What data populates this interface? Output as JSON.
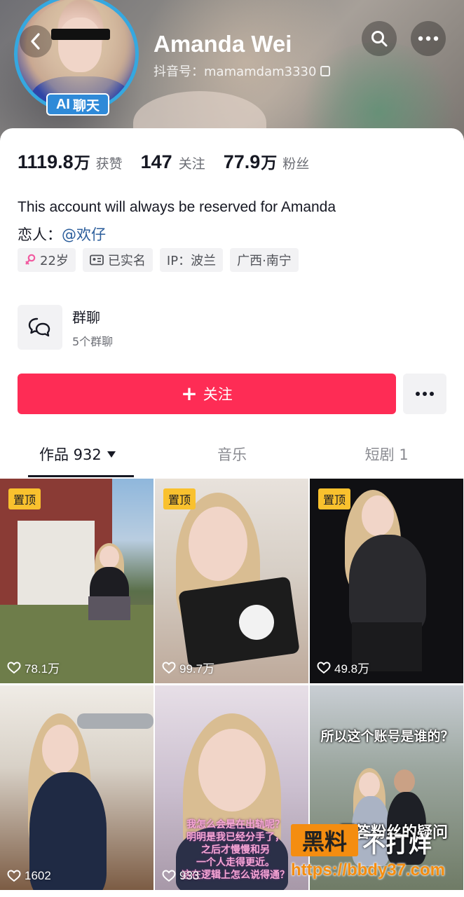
{
  "profile": {
    "name": "Amanda Wei",
    "douyin_id": "抖音号：mamamdam3330",
    "ai_badge_prefix": "AI",
    "ai_badge_label": "聊天"
  },
  "stats": [
    {
      "num": "1119.8",
      "unit": "万",
      "label": "获赞"
    },
    {
      "num": "147",
      "unit": "",
      "label": "关注"
    },
    {
      "num": "77.9",
      "unit": "万",
      "label": "粉丝"
    }
  ],
  "bio": "This account will always be reserved for Amanda",
  "lover": {
    "label": "恋人：",
    "mention": "@欢仔"
  },
  "tags": [
    {
      "icon": "female-icon",
      "text": "22岁"
    },
    {
      "icon": "id-card-icon",
      "text": "已实名"
    },
    {
      "icon": "",
      "text": "IP：波兰"
    },
    {
      "icon": "",
      "text": "广西·南宁"
    }
  ],
  "group_chat": {
    "title": "群聊",
    "subtitle": "5个群聊"
  },
  "follow_button": {
    "label": "关注"
  },
  "tabs": [
    {
      "label": "作品 932",
      "active": true
    },
    {
      "label": "音乐",
      "active": false
    },
    {
      "label": "短剧 1",
      "active": false
    }
  ],
  "videos": [
    {
      "pinned": true,
      "pin_label": "置顶",
      "likes": "78.1万"
    },
    {
      "pinned": true,
      "pin_label": "置顶",
      "likes": "99.7万"
    },
    {
      "pinned": true,
      "pin_label": "置顶",
      "likes": "49.8万"
    },
    {
      "pinned": false,
      "likes": "1602"
    },
    {
      "pinned": false,
      "likes": "933",
      "caption_lines": [
        "我怎么会是在出轨呢？",
        "明明是我已经分手了，",
        "之后才慢慢和另",
        "一个人走得更近。",
        "这在逻辑上怎么说得通？"
      ]
    },
    {
      "pinned": false,
      "likes": "",
      "caption_top": "所以这个账号是谁的？",
      "caption_bottom": "回答粉丝的疑问"
    }
  ],
  "watermark": {
    "box": "黑料",
    "text": "不打烊",
    "url": "https://bbdy37.com"
  },
  "colors": {
    "accent": "#fe2c55",
    "pin": "#f9c12e",
    "avatar_ring": "#35a8e0",
    "mention": "#2b5d9b"
  }
}
